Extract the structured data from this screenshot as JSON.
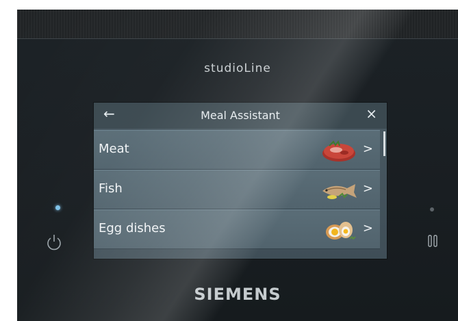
{
  "device": {
    "product_line": "studioLine",
    "brand": "SIEMENS"
  },
  "screen": {
    "header": {
      "back_icon": "←",
      "title": "Meal Assistant",
      "close_icon": "×"
    },
    "items": [
      {
        "label": "Meat",
        "chevron": ">",
        "image": "meat-steak"
      },
      {
        "label": "Fish",
        "chevron": ">",
        "image": "fish-dish"
      },
      {
        "label": "Egg dishes",
        "chevron": ">",
        "image": "boiled-eggs"
      }
    ]
  },
  "controls": {
    "power_icon": "power-icon",
    "pause_icon": "pause-icon",
    "power_led_color": "#7fc2e8"
  }
}
